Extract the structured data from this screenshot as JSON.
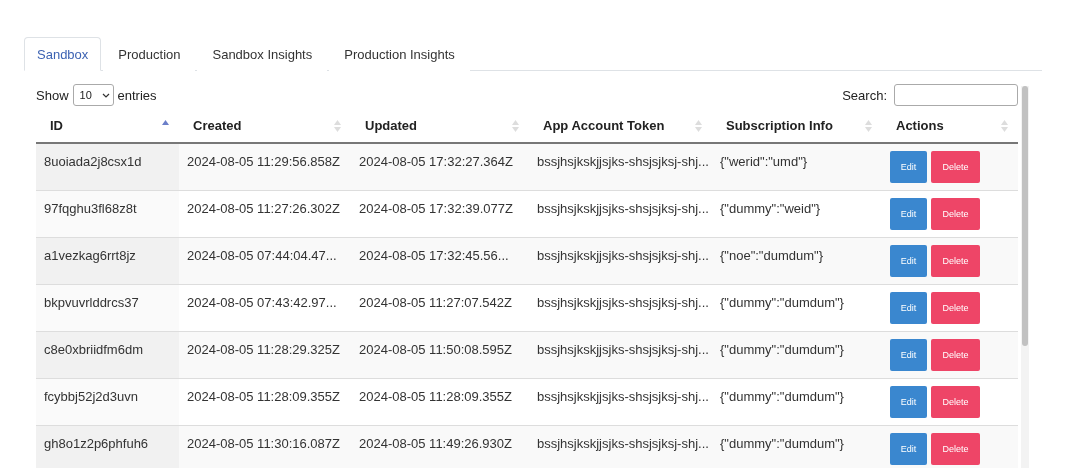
{
  "tabs": [
    {
      "label": "Sandbox",
      "selected": true
    },
    {
      "label": "Production",
      "selected": false
    },
    {
      "label": "Sandbox Insights",
      "selected": false
    },
    {
      "label": "Production Insights",
      "selected": false
    }
  ],
  "length_control": {
    "before": "Show",
    "value": "10",
    "after": "entries"
  },
  "search": {
    "label": "Search:"
  },
  "table": {
    "columns": [
      {
        "label": "ID",
        "sorted": true
      },
      {
        "label": "Created",
        "sorted": false
      },
      {
        "label": "Updated",
        "sorted": false
      },
      {
        "label": "App Account Token",
        "sorted": false
      },
      {
        "label": "Subscription Info",
        "sorted": false
      },
      {
        "label": "Actions",
        "sorted": false
      }
    ],
    "rows": [
      {
        "id": "8uoiada2j8csx1d",
        "created": "2024-08-05 11:29:56.858Z",
        "updated": "2024-08-05 17:32:27.364Z",
        "token": "bssjhsjkskjjsjks-shsjsjksj-shj...",
        "info": "{\"werid\":\"umd\"}",
        "actions": [
          "Edit",
          "Delete"
        ]
      },
      {
        "id": "97fqghu3fl68z8t",
        "created": "2024-08-05 11:27:26.302Z",
        "updated": "2024-08-05 17:32:39.077Z",
        "token": "bssjhsjkskjjsjks-shsjsjksj-shj...",
        "info": "{\"dummy\":\"weid\"}",
        "actions": [
          "Edit",
          "Delete"
        ]
      },
      {
        "id": "a1vezkag6rrt8jz",
        "created": "2024-08-05 07:44:04.47...",
        "updated": "2024-08-05 17:32:45.56...",
        "token": "bssjhsjkskjjsjks-shsjsjksj-shj...",
        "info": "{\"noe\":\"dumdum\"}",
        "actions": [
          "Edit",
          "Delete"
        ]
      },
      {
        "id": "bkpvuvrlddrcs37",
        "created": "2024-08-05 07:43:42.97...",
        "updated": "2024-08-05 11:27:07.542Z",
        "token": "bssjhsjkskjjsjks-shsjsjksj-shj...",
        "info": "{\"dummy\":\"dumdum\"}",
        "actions": [
          "Edit",
          "Delete"
        ]
      },
      {
        "id": "c8e0xbriidfm6dm",
        "created": "2024-08-05 11:28:29.325Z",
        "updated": "2024-08-05 11:50:08.595Z",
        "token": "bssjhsjkskjjsjks-shsjsjksj-shj...",
        "info": "{\"dummy\":\"dumdum\"}",
        "actions": [
          "Edit",
          "Delete"
        ]
      },
      {
        "id": "fcybbj52j2d3uvn",
        "created": "2024-08-05 11:28:09.355Z",
        "updated": "2024-08-05 11:28:09.355Z",
        "token": "bssjhsjkskjjsjks-shsjsjksj-shj...",
        "info": "{\"dummy\":\"dumdum\"}",
        "actions": [
          "Edit",
          "Delete"
        ]
      },
      {
        "id": "gh8o1z2p6phfuh6",
        "created": "2024-08-05 11:30:16.087Z",
        "updated": "2024-08-05 11:49:26.930Z",
        "token": "bssjhsjkskjjsjks-shsjsjksj-shj...",
        "info": "{\"dummy\":\"dumdum\"}",
        "actions": [
          "Edit",
          "Delete"
        ]
      }
    ]
  }
}
